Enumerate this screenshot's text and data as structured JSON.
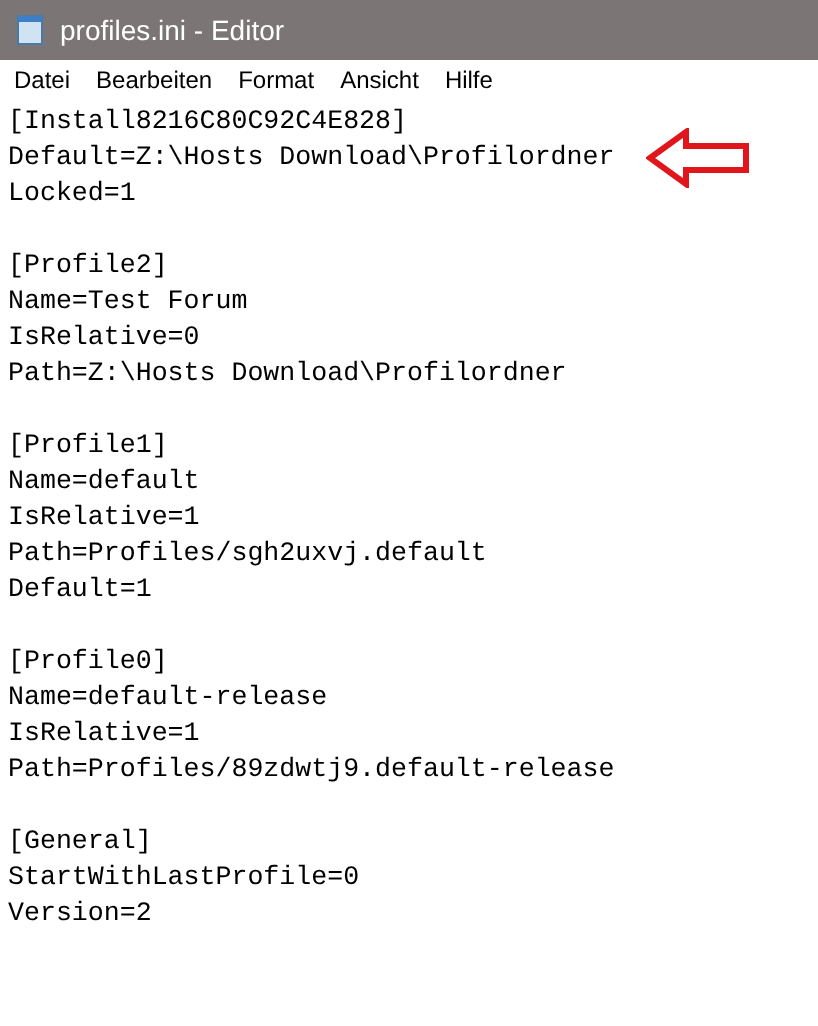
{
  "window": {
    "title": "profiles.ini - Editor"
  },
  "menu": [
    "Datei",
    "Bearbeiten",
    "Format",
    "Ansicht",
    "Hilfe"
  ],
  "document": {
    "sections": [
      {
        "lines": [
          {
            "text": "[Install8216C80C92C4E828]",
            "arrow": false
          },
          {
            "text": "Default=Z:\\Hosts Download\\Profilordner",
            "arrow": true
          },
          {
            "text": "Locked=1",
            "arrow": false
          }
        ]
      },
      {
        "lines": [
          {
            "text": "[Profile2]",
            "arrow": false
          },
          {
            "text": "Name=Test Forum",
            "arrow": false
          },
          {
            "text": "IsRelative=0",
            "arrow": false
          },
          {
            "text": "Path=Z:\\Hosts Download\\Profilordner",
            "arrow": false
          }
        ]
      },
      {
        "lines": [
          {
            "text": "[Profile1]",
            "arrow": false
          },
          {
            "text": "Name=default",
            "arrow": false
          },
          {
            "text": "IsRelative=1",
            "arrow": false
          },
          {
            "text": "Path=Profiles/sgh2uxvj.default",
            "arrow": false
          },
          {
            "text": "Default=1",
            "arrow": false
          }
        ]
      },
      {
        "lines": [
          {
            "text": "[Profile0]",
            "arrow": false
          },
          {
            "text": "Name=default-release",
            "arrow": false
          },
          {
            "text": "IsRelative=1",
            "arrow": false
          },
          {
            "text": "Path=Profiles/89zdwtj9.default-release",
            "arrow": false
          }
        ]
      },
      {
        "lines": [
          {
            "text": "[General]",
            "arrow": false
          },
          {
            "text": "StartWithLastProfile=0",
            "arrow": false
          },
          {
            "text": "Version=2",
            "arrow": false
          }
        ]
      }
    ]
  }
}
